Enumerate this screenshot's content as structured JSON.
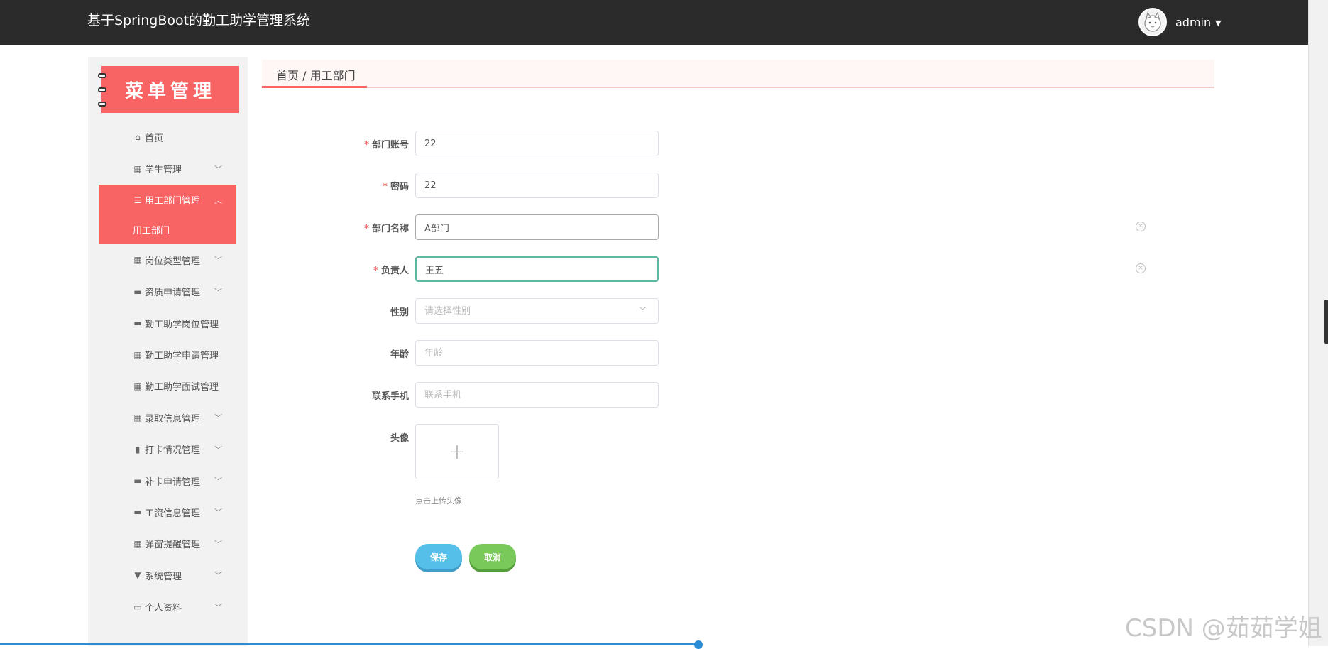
{
  "header": {
    "title": "基于SpringBoot的勤工助学管理系统",
    "username": "admin"
  },
  "sidebar": {
    "header_title": "菜单管理",
    "items": [
      {
        "label": "首页",
        "icon": "home-icon",
        "has_children": false
      },
      {
        "label": "学生管理",
        "icon": "grid-icon",
        "has_children": true
      },
      {
        "label": "用工部门管理",
        "icon": "sliders-icon",
        "has_children": true,
        "expanded": true
      },
      {
        "label": "岗位类型管理",
        "icon": "grid-icon",
        "has_children": true
      },
      {
        "label": "资质申请管理",
        "icon": "briefcase-icon",
        "has_children": true
      },
      {
        "label": "勤工助学岗位管理",
        "icon": "printer-icon",
        "has_children": false
      },
      {
        "label": "勤工助学申请管理",
        "icon": "grid-icon",
        "has_children": false
      },
      {
        "label": "勤工助学面试管理",
        "icon": "grid-icon",
        "has_children": false
      },
      {
        "label": "录取信息管理",
        "icon": "grid-icon",
        "has_children": true
      },
      {
        "label": "打卡情况管理",
        "icon": "clipboard-icon",
        "has_children": true
      },
      {
        "label": "补卡申请管理",
        "icon": "monitor-icon",
        "has_children": true
      },
      {
        "label": "工资信息管理",
        "icon": "message-icon",
        "has_children": true
      },
      {
        "label": "弹窗提醒管理",
        "icon": "grid-icon",
        "has_children": true
      },
      {
        "label": "系统管理",
        "icon": "tool-icon",
        "has_children": true
      },
      {
        "label": "个人资料",
        "icon": "card-icon",
        "has_children": true
      }
    ],
    "active_sub_item": "用工部门"
  },
  "breadcrumb": "首页 / 用工部门",
  "form": {
    "account": {
      "label": "部门账号",
      "value": "22",
      "required": true
    },
    "password": {
      "label": "密码",
      "value": "22",
      "required": true
    },
    "dept_name": {
      "label": "部门名称",
      "value": "A部门",
      "required": true
    },
    "manager": {
      "label": "负责人",
      "value": "王五",
      "required": true
    },
    "gender": {
      "label": "性别",
      "placeholder": "请选择性别"
    },
    "age": {
      "label": "年龄",
      "placeholder": "年龄"
    },
    "phone": {
      "label": "联系手机",
      "placeholder": "联系手机"
    },
    "avatar": {
      "label": "头像",
      "tip": "点击上传头像"
    },
    "save_label": "保存",
    "cancel_label": "取消"
  },
  "watermark": "CSDN @茹茹学姐",
  "colors": {
    "topbar": "#2b2b2b",
    "accent": "#f86464",
    "save": "#56bfe9",
    "cancel": "#78c85a"
  }
}
